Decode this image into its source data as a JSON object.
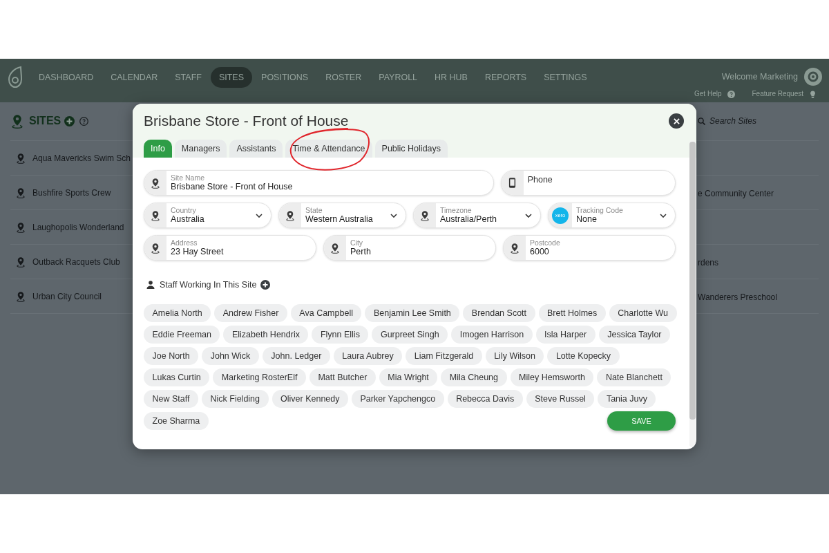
{
  "top_nav": {
    "items": [
      {
        "label": "DASHBOARD",
        "selected": false
      },
      {
        "label": "CALENDAR",
        "selected": false
      },
      {
        "label": "STAFF",
        "selected": false
      },
      {
        "label": "SITES",
        "selected": true
      },
      {
        "label": "POSITIONS",
        "selected": false
      },
      {
        "label": "ROSTER",
        "selected": false
      },
      {
        "label": "PAYROLL",
        "selected": false
      },
      {
        "label": "HR HUB",
        "selected": false
      },
      {
        "label": "REPORTS",
        "selected": false
      },
      {
        "label": "SETTINGS",
        "selected": false
      }
    ],
    "welcome": "Welcome Marketing",
    "links": [
      {
        "label": "Get Help",
        "kind": "help"
      },
      {
        "label": "Feature Request",
        "kind": "idea"
      }
    ]
  },
  "sites_page": {
    "title": "SITES",
    "search": {
      "placeholder": "Search Sites"
    },
    "rows": [
      {
        "left": "Aqua Mavericks Swim Sch"
      },
      {
        "left": "Bushfire Sports Crew",
        "right": "e Community Center"
      },
      {
        "left": "Laughopolis Wonderland"
      },
      {
        "left": "Outback Racquets Club",
        "right": "rdens"
      },
      {
        "left": "Urban City Council",
        "right": "Wanderers Preschool"
      }
    ]
  },
  "modal": {
    "title": "Brisbane Store - Front of House",
    "tabs": [
      {
        "label": "Info",
        "selected": true,
        "circled": false
      },
      {
        "label": "Managers",
        "selected": false,
        "circled": false
      },
      {
        "label": "Assistants",
        "selected": false,
        "circled": false
      },
      {
        "label": "Time & Attendance",
        "selected": false,
        "circled": true
      },
      {
        "label": "Public Holidays",
        "selected": false,
        "circled": false
      }
    ],
    "field_rows": [
      [
        {
          "kind": "text",
          "label": "Site Name",
          "value": "Brisbane Store - Front of House"
        },
        {
          "kind": "phone",
          "placeholder": "Phone"
        }
      ],
      [
        {
          "kind": "select",
          "label": "Country",
          "value": "Australia"
        },
        {
          "kind": "select",
          "label": "State",
          "value": "Western Australia"
        },
        {
          "kind": "select",
          "label": "Timezone",
          "value": "Australia/Perth"
        },
        {
          "kind": "tracking",
          "label": "Tracking Code",
          "value": "None",
          "logo_text": "xero"
        }
      ],
      [
        {
          "kind": "text",
          "label": "Address",
          "value": "23 Hay Street"
        },
        {
          "kind": "text",
          "label": "City",
          "value": "Perth"
        },
        {
          "kind": "text",
          "label": "Postcode",
          "value": "6000"
        }
      ]
    ],
    "staff": {
      "title": "Staff Working In This Site",
      "members": [
        "Amelia North",
        "Andrew Fisher",
        "Ava Campbell",
        "Benjamin Lee Smith",
        "Brendan Scott",
        "Brett Holmes",
        "Charlotte Wu",
        "Eddie Freeman",
        "Elizabeth Hendrix",
        "Flynn Ellis",
        "Gurpreet Singh",
        "Imogen Harrison",
        "Isla Harper",
        "Jessica Taylor",
        "Joe North",
        "John Wick",
        "John. Ledger",
        "Laura Aubrey",
        "Liam Fitzgerald",
        "Lily Wilson",
        "Lotte Kopecky",
        "Lukas Curtin",
        "Marketing RosterElf",
        "Matt Butcher",
        "Mia Wright",
        "Mila Cheung",
        "Miley Hemsworth",
        "Nate Blanchett",
        "New Staff",
        "Nick Fielding",
        "Oliver Kennedy",
        "Parker Yapchengco",
        "Rebecca Davis",
        "Steve Russel",
        "Tania Juvy",
        "Zoe Sharma"
      ]
    },
    "save_button": "SAVE"
  }
}
